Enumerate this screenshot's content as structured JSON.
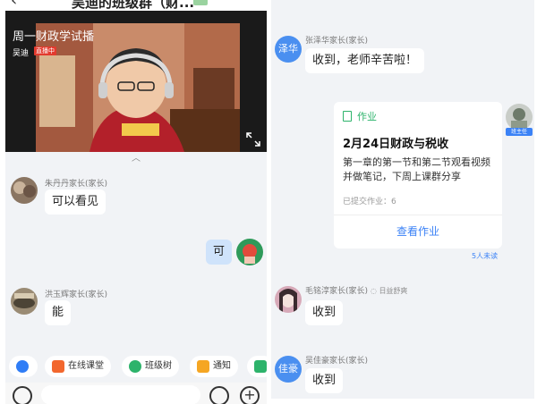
{
  "header": {
    "title": "吴迪的班级群（财...",
    "back_icon": "chevron-left-icon"
  },
  "video": {
    "title": "周一财政学试播",
    "presenter": "吴迪",
    "live_badge": "直播中",
    "fullscreen_icon": "fullscreen-icon"
  },
  "left_chat": [
    {
      "sender": "朱丹丹家长(家长)",
      "text": "可以看见"
    },
    {
      "sender": "",
      "text": "可"
    },
    {
      "sender": "洪玉辉家长(家长)",
      "text": "能"
    }
  ],
  "toolbar": {
    "items": [
      {
        "label": "",
        "icon": "blue-share-icon",
        "color": "#2f7df6"
      },
      {
        "label": "在线课堂",
        "icon": "classroom-icon",
        "color": "#f2672e"
      },
      {
        "label": "班级树",
        "icon": "tree-icon",
        "color": "#2db36b"
      },
      {
        "label": "通知",
        "icon": "megaphone-icon",
        "color": "#f5a623"
      },
      {
        "label": "",
        "icon": "green-card-icon",
        "color": "#2db36b"
      }
    ]
  },
  "input_bar": {
    "mic_icon": "mic-icon",
    "emoji_icon": "emoji-icon",
    "plus_icon": "plus-icon"
  },
  "right_chat": {
    "msg1": {
      "avatar_text": "泽华",
      "sender": "张泽华家长(家长)",
      "text": "收到，老师辛苦啦！"
    },
    "homework": {
      "header": "作业",
      "title": "2月24日财政与税收",
      "description": "第一章的第一节和第二节观看视频并做笔记，下周上课群分享",
      "meta": "已提交作业：6",
      "button": "查看作业",
      "unread": "5人未读",
      "teacher_label": "班主任"
    },
    "msg2": {
      "sender": "毛铭淳家长(家长)",
      "sticker": "日益舒爽",
      "text": "收到"
    },
    "msg3": {
      "avatar_text": "佳豪",
      "sender": "吴佳豪家长(家长)",
      "text": "收到"
    }
  }
}
